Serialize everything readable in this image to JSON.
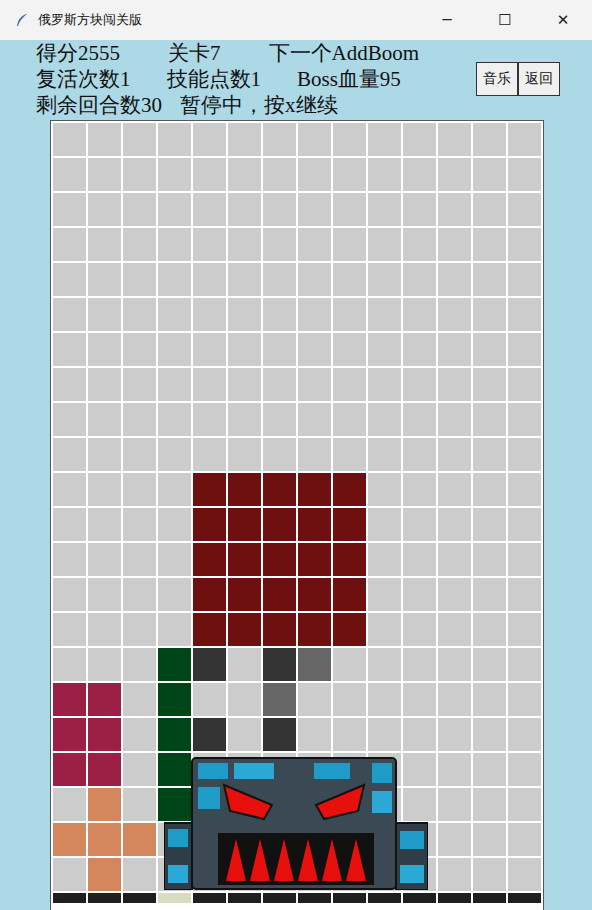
{
  "window": {
    "title": "俄罗斯方块闯关版",
    "controls": [
      "─",
      "☐",
      "✕"
    ]
  },
  "stats": [
    [
      "得分2555",
      "关卡7",
      "下一个AddBoom"
    ],
    [
      "复活次数1",
      "技能点数1",
      "Boss血量95"
    ],
    [
      "剩余回合数30",
      "暂停中，按x继续"
    ]
  ],
  "buttons": [
    "音乐",
    "返回"
  ],
  "board": {
    "palette": {
      ".": "#cccccc",
      "R": "#6e1010",
      "G": "#004517",
      "D": "#333333",
      "M": "#666666",
      "P": "#9c1f45",
      "O": "#d4865c",
      "K": "#1f1f1f",
      "B": "#d8dcc0"
    },
    "rows": [
      "..............",
      "..............",
      "..............",
      "..............",
      "..............",
      "..............",
      "..............",
      "..............",
      "..............",
      "..............",
      "....RRRRR.....",
      "....RRRRR.....",
      "....RRRRR.....",
      "....RRRRR.....",
      "....RRRRR.....",
      "...GD.DM......",
      "PP.G..M.......",
      "PP.GD.D.......",
      "PP.G..........",
      ".O.G..........",
      "OOO...........",
      ".O............"
    ],
    "floor": "KKKBKKKKKKKKKK",
    "boss": {
      "visible": true
    }
  }
}
